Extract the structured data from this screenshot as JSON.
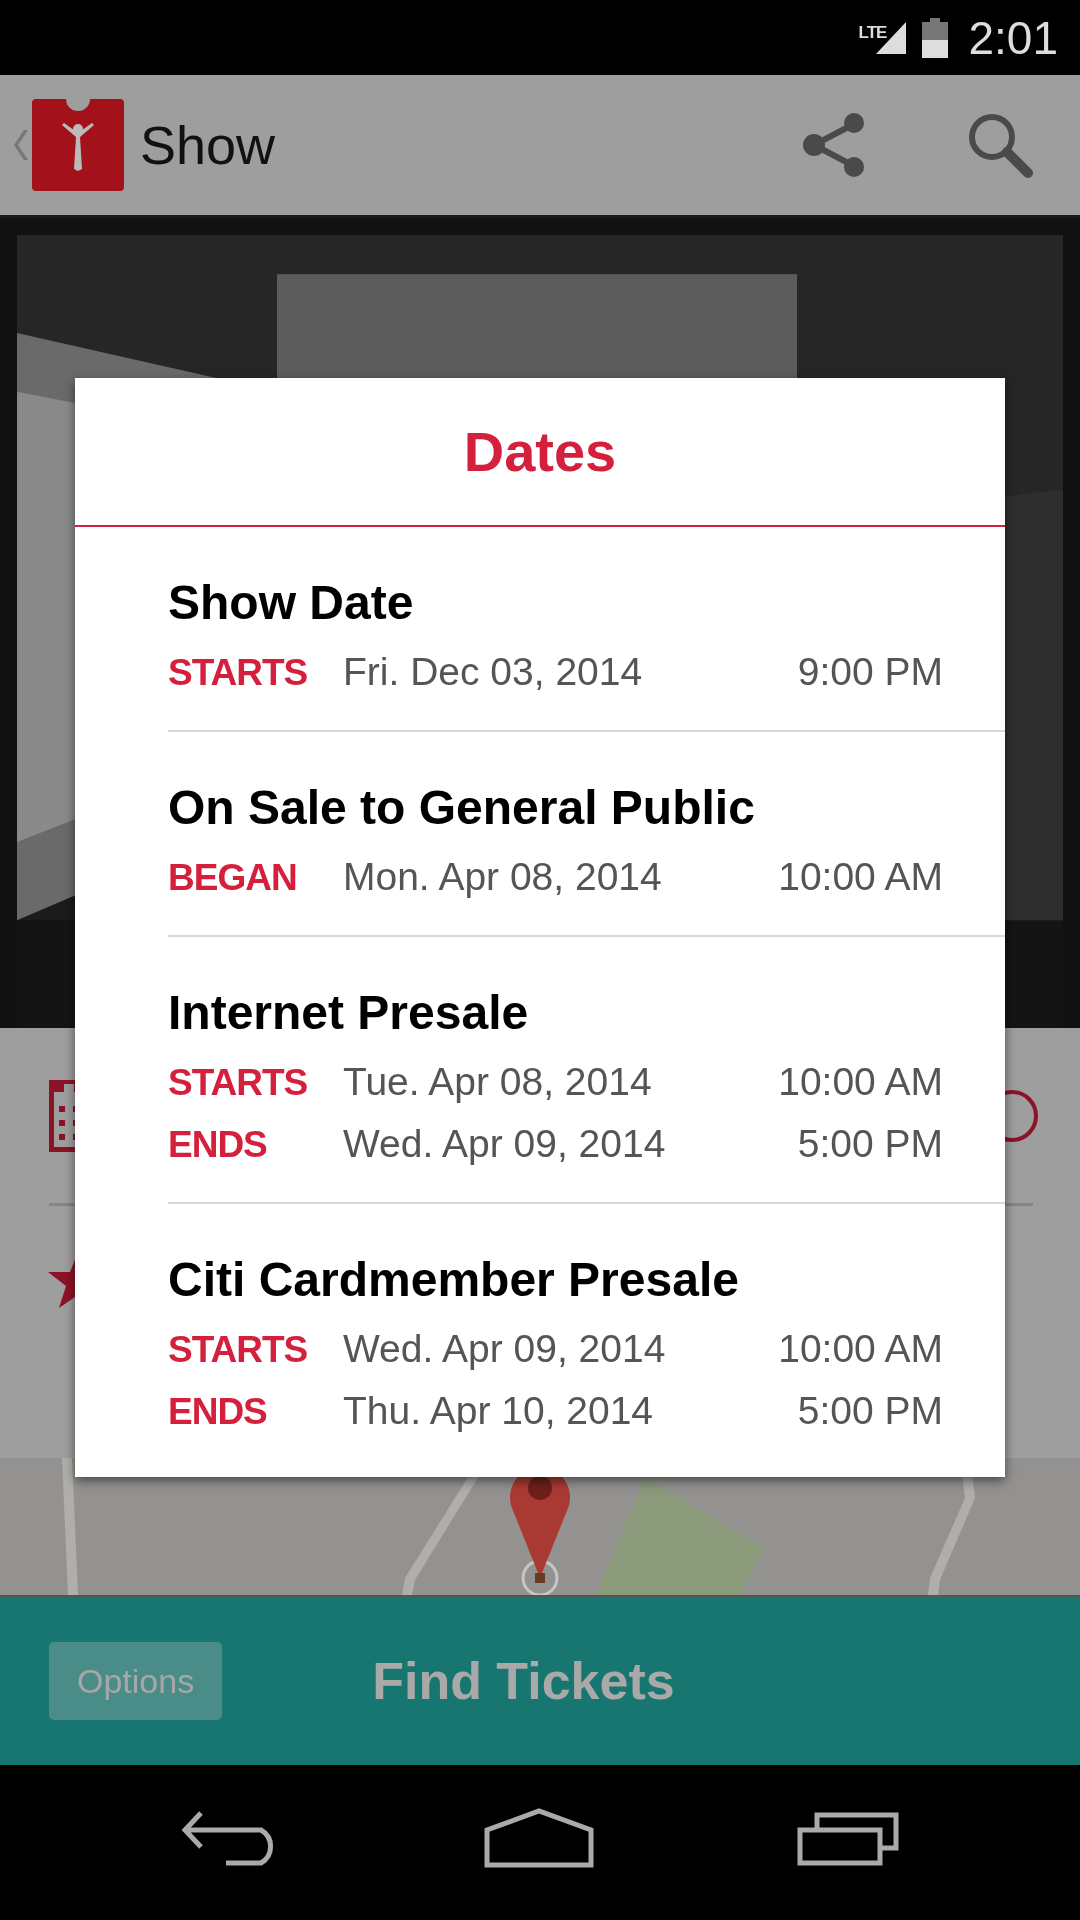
{
  "status_bar": {
    "network": "LTE",
    "time": "2:01"
  },
  "app_bar": {
    "title": "Show"
  },
  "dialog": {
    "title": "Dates",
    "sections": [
      {
        "title": "Show Date",
        "rows": [
          {
            "label": "STARTS",
            "date": "Fri. Dec 03, 2014",
            "time": "9:00 PM"
          }
        ]
      },
      {
        "title": "On Sale to General Public",
        "rows": [
          {
            "label": "BEGAN",
            "date": "Mon. Apr 08, 2014",
            "time": "10:00 AM"
          }
        ]
      },
      {
        "title": "Internet Presale",
        "rows": [
          {
            "label": "STARTS",
            "date": "Tue. Apr 08, 2014",
            "time": "10:00 AM"
          },
          {
            "label": "ENDS",
            "date": "Wed. Apr 09, 2014",
            "time": "5:00 PM"
          }
        ]
      },
      {
        "title": "Citi Cardmember Presale",
        "rows": [
          {
            "label": "STARTS",
            "date": "Wed. Apr 09, 2014",
            "time": "10:00 AM"
          },
          {
            "label": "ENDS",
            "date": "Thu. Apr 10, 2014",
            "time": "5:00 PM"
          }
        ]
      }
    ]
  },
  "bottom_bar": {
    "options_button": "Options",
    "primary_button": "Find Tickets"
  }
}
